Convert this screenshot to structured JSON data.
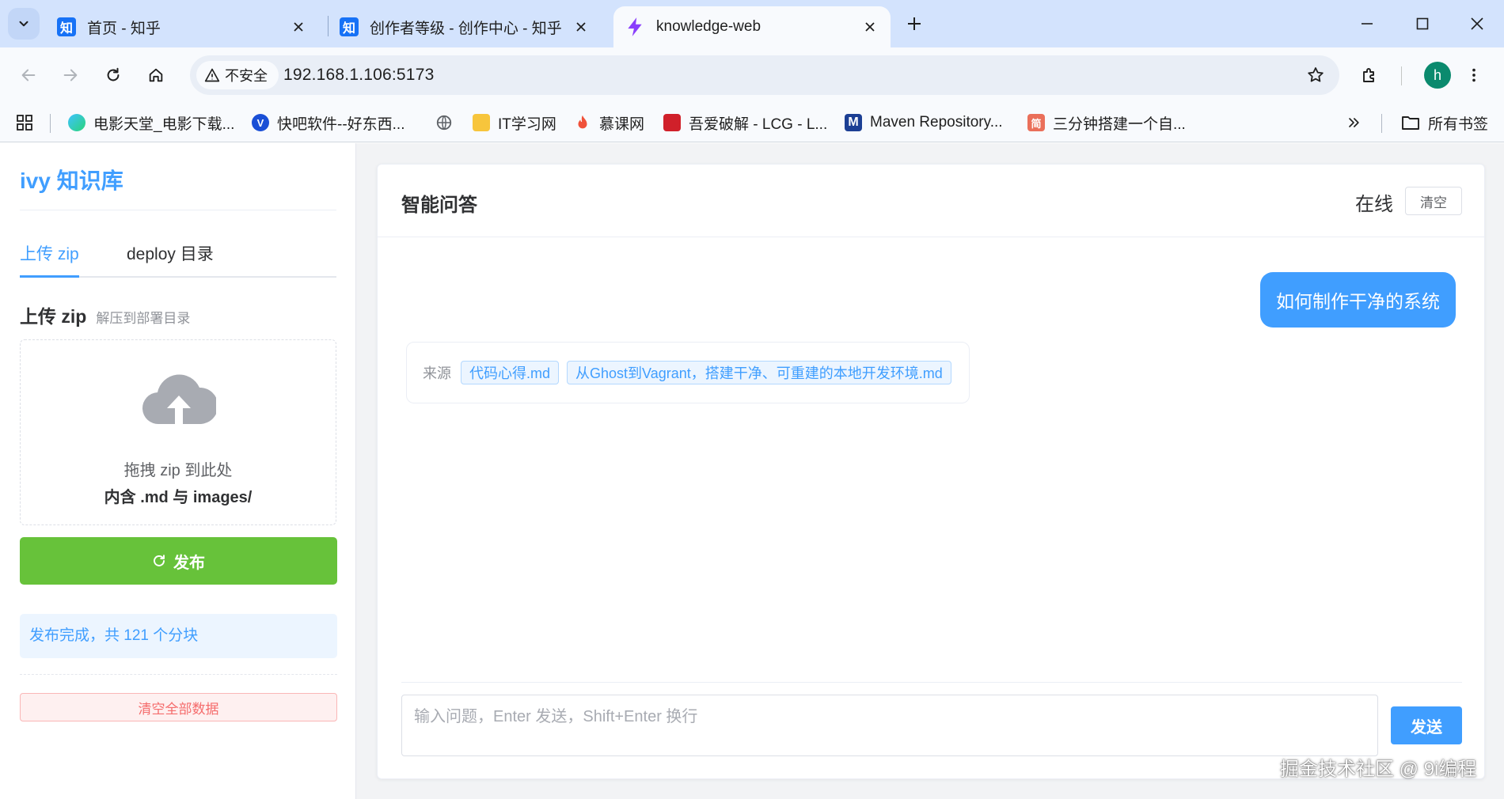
{
  "browser": {
    "tabs": [
      {
        "title": "首页 - 知乎",
        "favicon": "知"
      },
      {
        "title": "创作者等级 - 创作中心 - 知乎",
        "favicon": "知"
      },
      {
        "title": "knowledge-web"
      }
    ],
    "security_label": "不安全",
    "url": "192.168.1.106:5173",
    "avatar_letter": "h",
    "bookmarks": [
      {
        "label": "电影天堂_电影下载..."
      },
      {
        "label": "快吧软件--好东西..."
      },
      {
        "label": "IT学习网"
      },
      {
        "label": "慕课网"
      },
      {
        "label": "吾爱破解 - LCG - L..."
      },
      {
        "label": "Maven Repository..."
      },
      {
        "label": "三分钟搭建一个自..."
      }
    ],
    "all_bookmarks_label": "所有书签",
    "bookmark_icon_texts": {
      "maven": "M",
      "jian": "简"
    }
  },
  "sidebar": {
    "brand": "ivy 知识库",
    "tabs": [
      {
        "label": "上传 zip"
      },
      {
        "label": "deploy 目录"
      }
    ],
    "section_title": "上传 zip",
    "section_subtitle": "解压到部署目录",
    "dropzone_line1": "拖拽 zip 到此处",
    "dropzone_line2": "内含 .md 与 images/",
    "publish_label": "发布",
    "notice": "发布完成，共 121 个分块",
    "clear_all_label": "清空全部数据"
  },
  "chat": {
    "title": "智能问答",
    "status": "在线",
    "clear_label": "清空",
    "user_message": "如何制作干净的系统",
    "sources_label": "来源",
    "sources": [
      "代码心得.md",
      "从Ghost到Vagrant，搭建干净、可重建的本地开发环境.md"
    ],
    "input_placeholder": "输入问题，Enter 发送，Shift+Enter 换行",
    "input_value": "",
    "send_label": "发送"
  },
  "watermark": "掘金技术社区 @ 9i编程",
  "colors": {
    "primary": "#409eff",
    "success": "#67c23a",
    "danger": "#f56c6c",
    "tabstrip": "#d3e3fd"
  }
}
